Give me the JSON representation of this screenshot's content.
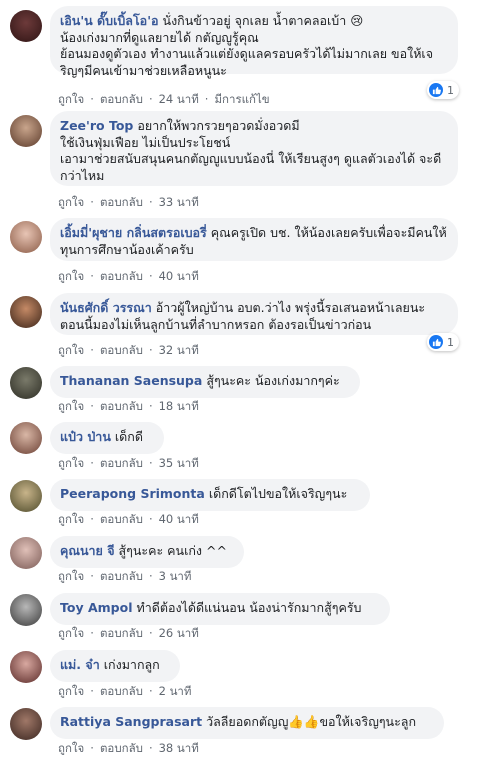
{
  "labels": {
    "like": "ถูกใจ",
    "reply": "ตอบกลับ",
    "edited": "มีการแก้ไข",
    "separator": "·"
  },
  "colors": {
    "author": "#385898",
    "bubble": "#f2f3f5",
    "meta": "#606770",
    "like_badge": "#1877f2"
  },
  "comments": [
    {
      "author": "เอิน'น ดั๊บเบิ้ลโอ'อ",
      "text": "นั่งกินข้าวอยู่ จุกเลย น้ำตาคลอเบ้า 😢\nน้องเก่งมากที่ดูแลยายได้ กตัญญูรู้คุณ\nย้อนมองดูตัวเอง ทำงานแล้วแต่ยังดูแลครอบครัวได้ไม่มากเลย ขอให้เจริญๆมีคนเข้ามาช่วยเหลือหนูนะ",
      "time": "24 นาที",
      "edited": true,
      "likes": "1"
    },
    {
      "author": "Zee'ro Top",
      "text": "อยากให้พวกรวยๆอวดมั่งอวดมี\nใช้เงินฟุ่มเฟือย ไม่เป็นประโยชน์\nเอามาช่วยสนับสนุนคนกตัญญูแบบน้องนี่ ให้เรียนสูงๆ ดูแลตัวเองได้ จะดีกว่าไหม",
      "time": "33 นาที"
    },
    {
      "author": "เอิ้มมี่'ผุชาย กลิ่นสตรอเบอรี่",
      "text": "คุณครูเปิด บช. ให้น้องเลยครับเพื่อจะมีคนให้ทุนการศึกษาน้องเค้าครับ",
      "time": "40 นาที"
    },
    {
      "author": "นันธศักดิ์ วรรณา",
      "text": "อ้าวผู้ใหญ่บ้าน อบต.ว่าไง พรุ่งนี้รอเสนอหน้าเลยนะ ตอนนี้มองไม่เห็นลูกบ้านที่ลำบากหรอก ต้องรอเป็นข่าวก่อน",
      "time": "32 นาที",
      "likes": "1"
    },
    {
      "author": "Thananan Saensupa",
      "text": "สู้ๆนะคะ น้องเก่งมากๆค่ะ",
      "time": "18 นาที"
    },
    {
      "author": "แป๋ว ป่าน",
      "text": "เด็กดี",
      "time": "35 นาที"
    },
    {
      "author": "Peerapong Srimonta",
      "text": "เด็กดีโตไปขอให้เจริญๆนะ",
      "time": "40 นาที"
    },
    {
      "author": "คุณนาย จี",
      "text": "สู้ๆนะคะ คนเก่ง ^^",
      "time": "3 นาที"
    },
    {
      "author": "Toy Ampol",
      "text": "ทำดีต้องได้ดีแน่นอน น้องน่ารักมากสู้ๆครับ",
      "time": "26 นาที"
    },
    {
      "author": "แม่. จ๋า",
      "text": "เก่งมากลูก",
      "time": "2 นาที"
    },
    {
      "author": "Rattiya Sangprasart",
      "text": "วัลลียอดกตัญญู👍👍ขอให้เจริญๆนะลูก",
      "time": "38 นาที"
    }
  ]
}
